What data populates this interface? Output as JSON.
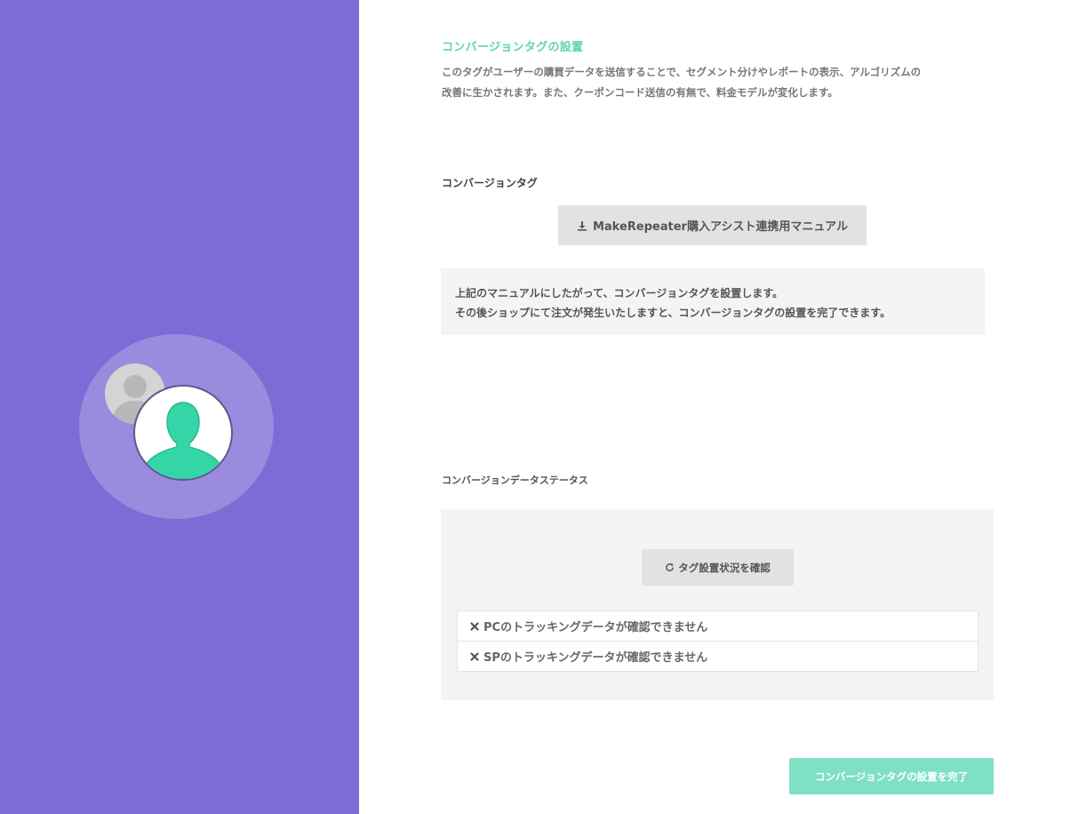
{
  "sidebar": {
    "avatar_icon": "user-avatar-icon",
    "secondary_avatar_icon": "user-avatar-icon"
  },
  "header": {
    "title": "コンバージョンタグの設置",
    "description_lines": [
      "このタグがユーザーの購買データを送信することで、セグメント分けやレポートの表示、アルゴリズムの",
      "改善に生かされます。また、クーポンコード送信の有無で、料金モデルが変化します。"
    ]
  },
  "conversion_tag": {
    "label": "コンバージョンタグ",
    "manual_button_label": "MakeRepeater購入アシスト連携用マニュアル",
    "manual_button_icon": "download-icon",
    "note_lines": [
      "上記のマニュアルにしたがって、コンバージョンタグを設置します。",
      "その後ショップにて注文が発生いたしますと、コンバージョンタグの設置を完了できます。"
    ]
  },
  "status": {
    "label": "コンバージョンデータステータス",
    "check_button_label": "タグ設置状況を確認",
    "check_button_icon": "refresh-icon",
    "items": [
      {
        "icon": "close-icon",
        "text": "PCのトラッキングデータが確認できません"
      },
      {
        "icon": "close-icon",
        "text": "SPのトラッキングデータが確認できません"
      }
    ]
  },
  "footer": {
    "complete_button_label": "コンバージョンタグの設置を完了"
  },
  "colors": {
    "sidebar_bg": "#7e6bd6",
    "accent": "#5fd3b2",
    "complete_button_bg": "#7fe0c6",
    "avatar_green": "#34d6a8"
  }
}
